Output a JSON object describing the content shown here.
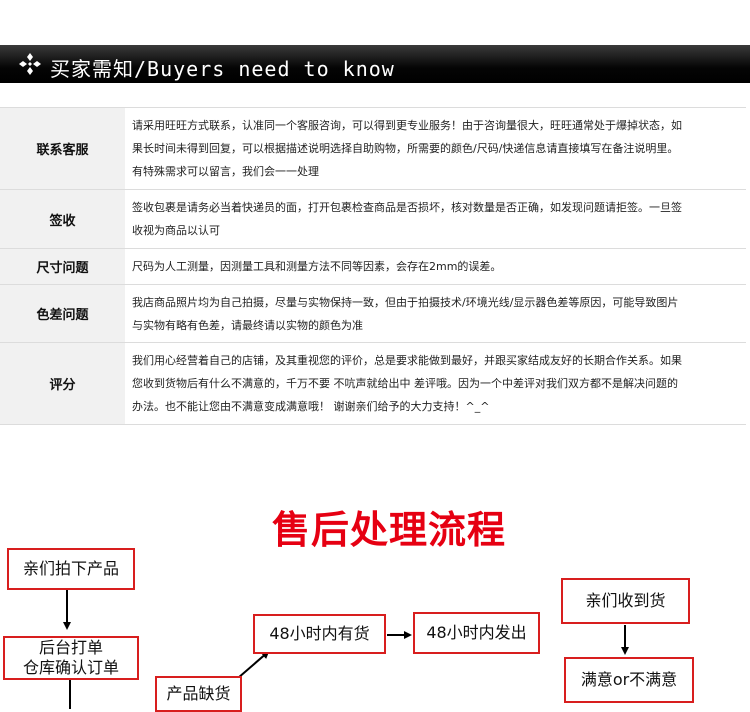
{
  "header": {
    "title": "买家需知/Buyers need to know",
    "icon": "diamond-cluster-icon"
  },
  "info_rows": [
    {
      "label": "联系客服",
      "lines": [
        "请采用旺旺方式联系，认准同一个客服咨询，可以得到更专业服务！由于咨询量很大，旺旺通常处于爆掉状态，如",
        "果长时间未得到回复，可以根据描述说明选择自助购物，所需要的颜色/尺码/快递信息请直接填写在备注说明里。",
        "有特殊需求可以留言，我们会一一处理"
      ]
    },
    {
      "label": "签收",
      "lines": [
        "签收包裹是请务必当着快递员的面，打开包裹检查商品是否损坏，核对数量是否正确，如发现问题请拒签。一旦签",
        "收视为商品以认可"
      ]
    },
    {
      "label": "尺寸问题",
      "lines": [
        "尺码为人工测量，因测量工具和测量方法不同等因素，会存在2mm的误差。"
      ]
    },
    {
      "label": "色差问题",
      "lines": [
        "我店商品照片均为自己拍摄，尽量与实物保持一致，但由于拍摄技术/环境光线/显示器色差等原因，可能导致图片",
        "与实物有略有色差，请最终请以实物的颜色为准"
      ]
    },
    {
      "label": "评分",
      "lines": [
        "我们用心经营着自己的店铺，及其重视您的评价，总是要求能做到最好，并跟买家结成友好的长期合作关系。如果",
        "您收到货物后有什么不满意的，千万不要 不吭声就给出中 差评哦。因为一个中差评对我们双方都不是解决问题的",
        "办法。也不能让您由不满意变成满意哦！ 谢谢亲们给予的大力支持！^_^"
      ]
    }
  ],
  "flow": {
    "title": "售后处理流程",
    "boxes": {
      "buy": "亲们拍下产品",
      "backend_line1": "后台打单",
      "backend_line2": "仓库确认订单",
      "in_stock": "48小时内有货",
      "ship": "48小时内发出",
      "out_of_stock": "产品缺货",
      "received": "亲们收到货",
      "satisfied": "满意or不满意"
    },
    "colors": {
      "title": "#e60012",
      "box_border": "#d81e1e",
      "arrow": "#000000"
    }
  }
}
